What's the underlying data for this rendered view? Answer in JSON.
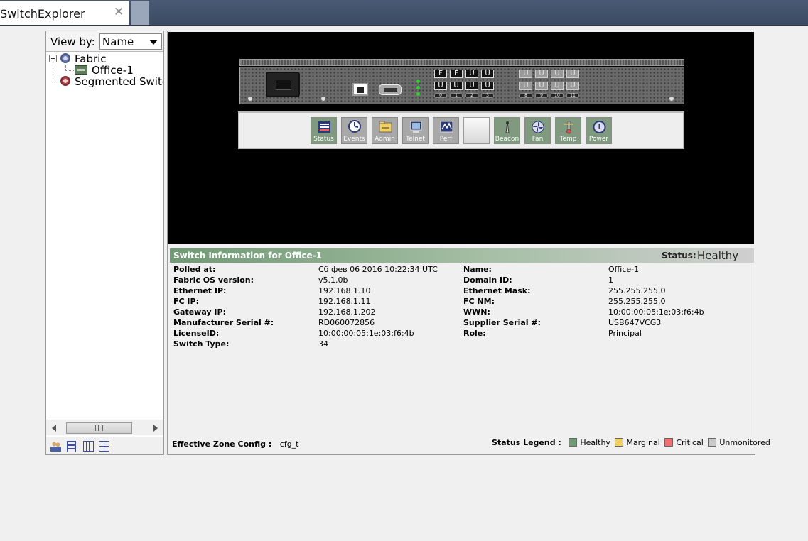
{
  "tab": {
    "title": "SwitchExplorer",
    "close": "✕"
  },
  "left": {
    "view_by_label": "View by:",
    "view_by_value": "Name",
    "tree": [
      {
        "label": "Fabric"
      },
      {
        "label": "Office-1"
      },
      {
        "label": "Segmented Switches"
      }
    ]
  },
  "panel": {
    "port_labels_top": [
      "F",
      "F",
      "U",
      "U"
    ],
    "port_labels_bottom": [
      "U",
      "U",
      "U",
      "U"
    ],
    "port_labels_right_top": [
      "U",
      "U",
      "U",
      "U"
    ],
    "port_labels_right_bottom": [
      "U",
      "U",
      "U",
      "U"
    ],
    "port_numbers_left": [
      "0",
      "1",
      "2",
      "3"
    ],
    "port_numbers_right": [
      "8",
      "9",
      "10",
      "11"
    ],
    "toolbar": [
      {
        "label": "Status",
        "icon": "status-icon"
      },
      {
        "label": "Events",
        "icon": "events-icon"
      },
      {
        "label": "Admin",
        "icon": "admin-icon"
      },
      {
        "label": "Telnet",
        "icon": "telnet-icon"
      },
      {
        "label": "Perf",
        "icon": "perf-icon"
      },
      {
        "label": "",
        "icon": "blank-icon"
      },
      {
        "label": "Beacon",
        "icon": "beacon-icon"
      },
      {
        "label": "Fan",
        "icon": "fan-icon"
      },
      {
        "label": "Temp",
        "icon": "temp-icon"
      },
      {
        "label": "Power",
        "icon": "power-icon"
      }
    ]
  },
  "info": {
    "title": "Switch Information for Office-1",
    "status_key": "Status:",
    "status_value": "Healthy",
    "left_fields": [
      {
        "key": "Polled at:",
        "value": "Сб фев 06 2016 10:22:34 UTC"
      },
      {
        "key": "Fabric OS version:",
        "value": "v5.1.0b"
      },
      {
        "key": "Ethernet IP:",
        "value": "192.168.1.10"
      },
      {
        "key": "FC IP:",
        "value": "192.168.1.11"
      },
      {
        "key": "Gateway IP:",
        "value": "192.168.1.202"
      },
      {
        "key": "Manufacturer Serial #:",
        "value": "RD060072856"
      },
      {
        "key": "LicenseID:",
        "value": "10:00:00:05:1e:03:f6:4b"
      },
      {
        "key": "Switch Type:",
        "value": "34"
      }
    ],
    "right_fields": [
      {
        "key": "Name:",
        "value": "Office-1"
      },
      {
        "key": "Domain ID:",
        "value": "1"
      },
      {
        "key": "Ethernet Mask:",
        "value": "255.255.255.0"
      },
      {
        "key": "FC NM:",
        "value": "255.255.255.0"
      },
      {
        "key": "WWN:",
        "value": "10:00:00:05:1e:03:f6:4b"
      },
      {
        "key": "Supplier Serial #:",
        "value": "USB647VCG3"
      },
      {
        "key": "Role:",
        "value": "Principal"
      }
    ],
    "zone_key": "Effective Zone Config :",
    "zone_value": "cfg_t",
    "legend_key": "Status Legend :",
    "legend": [
      {
        "label": "Healthy",
        "color": "#6f9a73"
      },
      {
        "label": "Marginal",
        "color": "#f3d05f"
      },
      {
        "label": "Critical",
        "color": "#f07070"
      },
      {
        "label": "Unmonitored",
        "color": "#c8c8c8"
      }
    ]
  }
}
